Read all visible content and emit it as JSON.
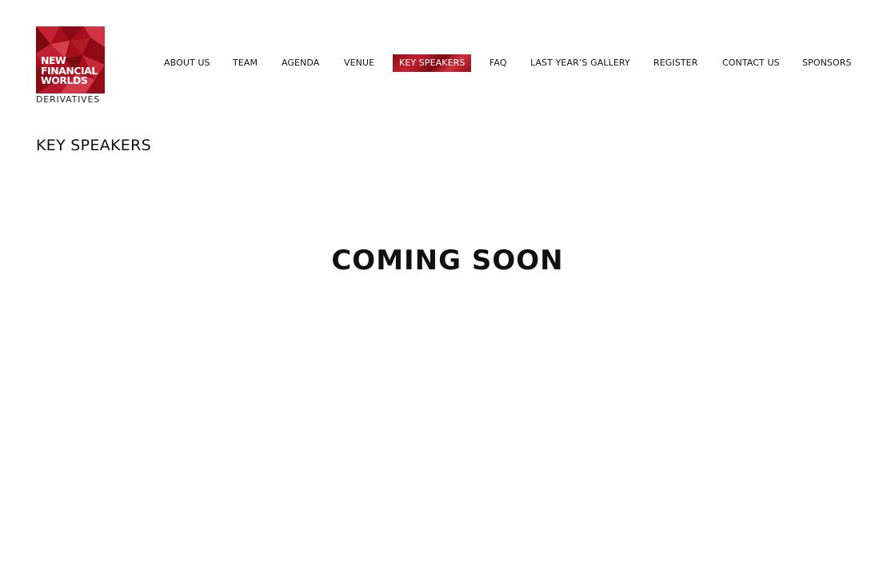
{
  "brand": {
    "logo_lines": [
      "NEW",
      "FINANCIAL",
      "WORLDS"
    ],
    "logo_sub": "DERIVATIVES",
    "accent_color": "#b3121f"
  },
  "nav": {
    "items": [
      {
        "label": "ABOUT US",
        "active": false
      },
      {
        "label": "TEAM",
        "active": false
      },
      {
        "label": "AGENDA",
        "active": false
      },
      {
        "label": "VENUE",
        "active": false
      },
      {
        "label": "KEY SPEAKERS",
        "active": true
      },
      {
        "label": "FAQ",
        "active": false
      },
      {
        "label": "LAST YEAR’S GALLERY",
        "active": false
      },
      {
        "label": "REGISTER",
        "active": false
      },
      {
        "label": "CONTACT US",
        "active": false
      },
      {
        "label": "SPONSORS",
        "active": false
      }
    ]
  },
  "main": {
    "page_title": "KEY SPEAKERS",
    "message": "COMING SOON"
  }
}
